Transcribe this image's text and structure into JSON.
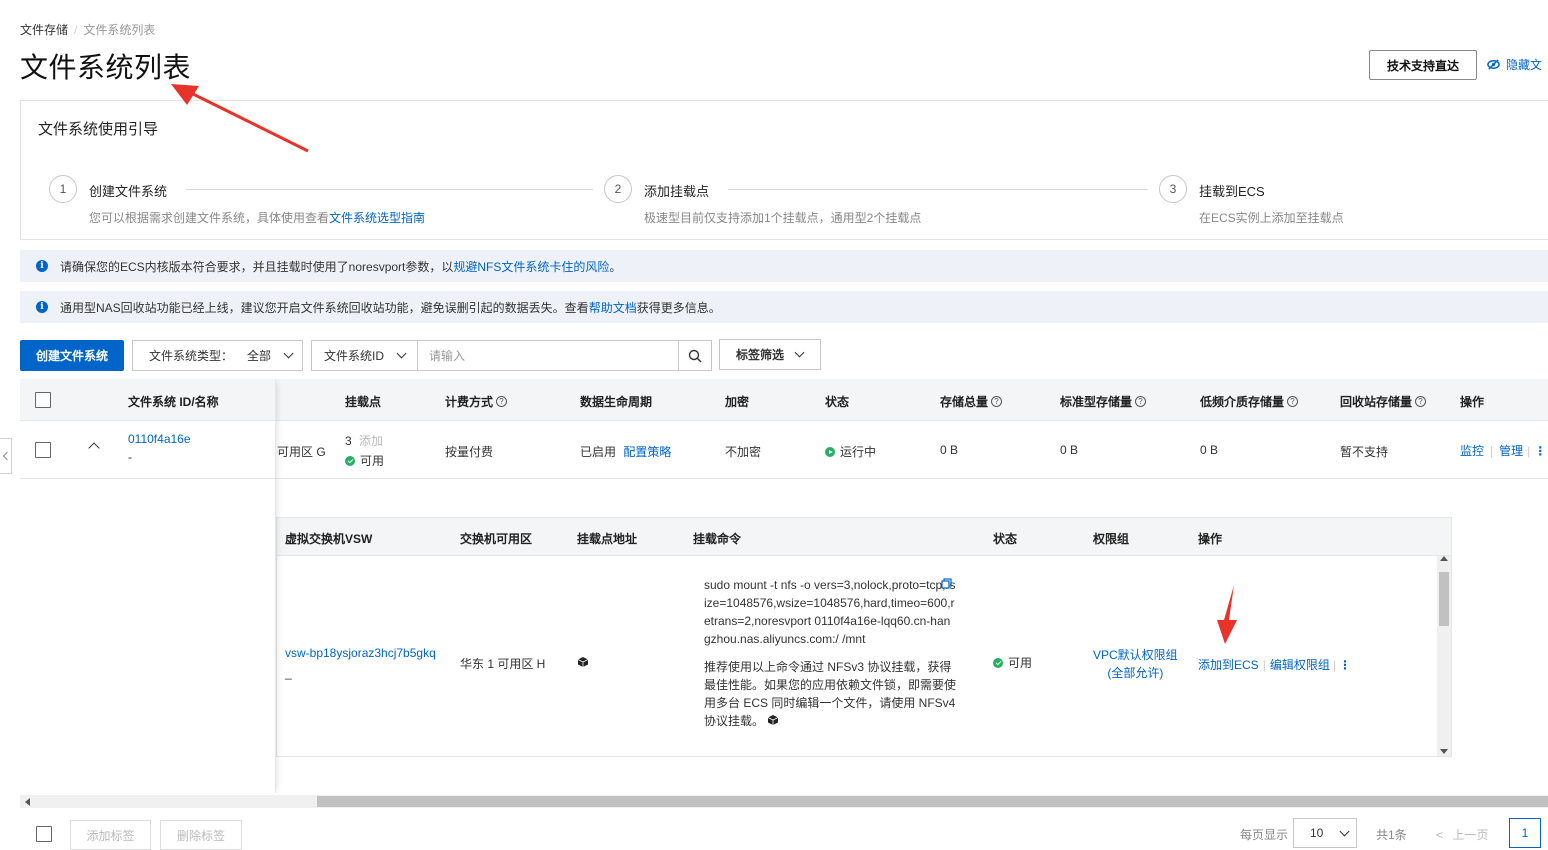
{
  "breadcrumb": {
    "root": "文件存储",
    "separator": "/",
    "current": "文件系统列表"
  },
  "page_title": "文件系统列表",
  "header": {
    "support_button": "技术支持直达",
    "hide_link": "隐藏文"
  },
  "guide": {
    "title": "文件系统使用引导",
    "steps": [
      {
        "num": "1",
        "title": "创建文件系统",
        "desc_prefix": "您可以根据需求创建文件系统，具体使用查看",
        "desc_link": "文件系统选型指南"
      },
      {
        "num": "2",
        "title": "添加挂载点",
        "desc": "极速型目前仅支持添加1个挂载点，通用型2个挂载点"
      },
      {
        "num": "3",
        "title": "挂载到ECS",
        "desc": "在ECS实例上添加至挂载点"
      }
    ]
  },
  "notices": [
    {
      "text": "请确保您的ECS内核版本符合要求，并且挂载时使用了noresvport参数，以",
      "link": "规避NFS文件系统卡住的风险",
      "suffix": "。"
    },
    {
      "text": "通用型NAS回收站功能已经上线，建议您开启文件系统回收站功能，避免误删引起的数据丢失。查看",
      "link": "帮助文档",
      "suffix": "获得更多信息。"
    }
  ],
  "toolbar": {
    "create_button": "创建文件系统",
    "type_filter_label": "文件系统类型：",
    "type_filter_value": "全部",
    "search_field": "文件系统ID",
    "search_placeholder": "请输入",
    "tag_filter": "标签筛选"
  },
  "table": {
    "headers": {
      "id_name": "文件系统 ID/名称",
      "mount_point": "挂载点",
      "billing": "计费方式",
      "lifecycle": "数据生命周期",
      "encryption": "加密",
      "status": "状态",
      "storage_total": "存储总量",
      "standard_storage": "标准型存储量",
      "ia_storage": "低频介质存储量",
      "recycle_storage": "回收站存储量",
      "actions": "操作"
    },
    "row": {
      "id": "0110f4a16e",
      "name": "-",
      "zone_partial": "可用区 G",
      "mount_count": "3",
      "mount_add": "添加",
      "mount_status": "可用",
      "billing": "按量付费",
      "lifecycle_status": "已启用",
      "lifecycle_link": "配置策略",
      "encryption": "不加密",
      "status": "运行中",
      "storage_total": "0 B",
      "standard_storage": "0 B",
      "ia_storage": "0 B",
      "recycle_storage": "暂不支持",
      "action_monitor": "监控",
      "action_manage": "管理"
    }
  },
  "sub_table": {
    "headers": {
      "vsw": "虚拟交换机VSW",
      "zone": "交换机可用区",
      "address": "挂载点地址",
      "command": "挂载命令",
      "status": "状态",
      "permission_group": "权限组",
      "actions": "操作"
    },
    "row": {
      "vsw": "vsw-bp18ysjoraz3hcj7b5gkq",
      "vsw_sub": "_",
      "zone": "华东 1 可用区 H",
      "command": "sudo mount -t nfs -o vers=3,nolock,proto=tcp,rsize=1048576,wsize=1048576,hard,timeo=600,retrans=2,noresvport 0110f4a16e-lqq60.cn-hangzhou.nas.aliyuncs.com:/ /mnt",
      "recommend": "推荐使用以上命令通过 NFSv3 协议挂载，获得最佳性能。如果您的应用依赖文件锁，即需要使用多台 ECS 同时编辑一个文件，请使用 NFSv4 协议挂载。",
      "status": "可用",
      "permission_group": "VPC默认权限组",
      "permission_group_sub": "(全部允许)",
      "action_add_ecs": "添加到ECS",
      "action_edit": "编辑权限组"
    }
  },
  "footer": {
    "add_tag": "添加标签",
    "delete_tag": "删除标签",
    "page_size_label": "每页显示",
    "page_size": "10",
    "total": "共1条",
    "prev": "上一页",
    "current_page": "1"
  },
  "colors": {
    "accent": "#0064c8",
    "success": "#23b066",
    "annotation_arrow": "#e8332a",
    "header_bg": "#f4f5f7",
    "notice_bg": "#eef2f8"
  }
}
